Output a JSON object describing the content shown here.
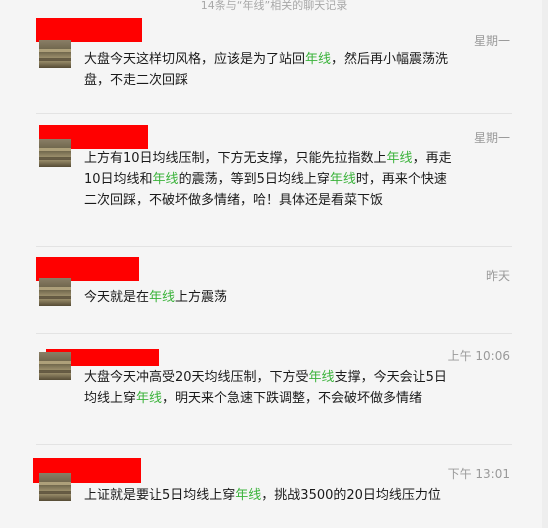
{
  "header": {
    "title": "14条与“年线”相关的聊天记录"
  },
  "messages": [
    {
      "time": "星期一",
      "parts": [
        {
          "t": "大盘今天这样切风格，应该是为了站回"
        },
        {
          "t": "年线",
          "hl": true
        },
        {
          "t": "，然后再小幅震荡洗盘，不走二次回踩"
        }
      ]
    },
    {
      "time": "星期一",
      "parts": [
        {
          "t": "上方有10日均线压制，下方无支撑，只能先拉指数上"
        },
        {
          "t": "年线",
          "hl": true
        },
        {
          "t": "，再走10日均线和"
        },
        {
          "t": "年线",
          "hl": true
        },
        {
          "t": "的震荡，等到5日均线上穿"
        },
        {
          "t": "年线",
          "hl": true
        },
        {
          "t": "时，再来个快速二次回踩，不破坏做多情绪，哈！具体还是看菜下饭"
        }
      ]
    },
    {
      "time": "昨天",
      "parts": [
        {
          "t": "今天就是在"
        },
        {
          "t": "年线",
          "hl": true
        },
        {
          "t": "上方震荡"
        }
      ]
    },
    {
      "time": "上午 10:06",
      "parts": [
        {
          "t": "大盘今天冲高受20天均线压制，下方受"
        },
        {
          "t": "年线",
          "hl": true
        },
        {
          "t": "支撑，今天会让5日均线上穿"
        },
        {
          "t": "年线",
          "hl": true
        },
        {
          "t": "，明天来个急速下跌调整，不会破坏做多情绪"
        }
      ]
    },
    {
      "time": "下午 13:01",
      "parts": [
        {
          "t": " 上证就是要让5日均线上穿"
        },
        {
          "t": "年线",
          "hl": true
        },
        {
          "t": "，挑战3500的20日均线压力位"
        }
      ]
    }
  ],
  "colors": {
    "highlight": "#3bb33b",
    "redaction": "#ff0000",
    "background": "#f5f5f5"
  }
}
